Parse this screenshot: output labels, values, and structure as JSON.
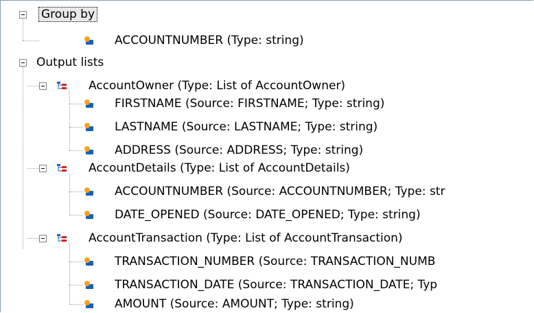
{
  "tree": {
    "group_by": {
      "label": "Group by",
      "items": [
        "ACCOUNTNUMBER (Type: string)"
      ]
    },
    "output_lists": {
      "label": "Output lists",
      "lists": [
        {
          "label": "AccountOwner (Type: List of AccountOwner)",
          "fields": [
            "FIRSTNAME (Source: FIRSTNAME; Type: string)",
            "LASTNAME (Source: LASTNAME; Type: string)",
            "ADDRESS (Source: ADDRESS; Type: string)"
          ]
        },
        {
          "label": "AccountDetails (Type: List of AccountDetails)",
          "fields": [
            "ACCOUNTNUMBER (Source: ACCOUNTNUMBER; Type: str",
            "DATE_OPENED (Source: DATE_OPENED; Type: string)"
          ]
        },
        {
          "label": "AccountTransaction (Type: List of AccountTransaction)",
          "fields": [
            "TRANSACTION_NUMBER (Source: TRANSACTION_NUMB",
            "TRANSACTION_DATE (Source: TRANSACTION_DATE; Typ",
            "AMOUNT (Source: AMOUNT; Type: string)"
          ]
        }
      ]
    }
  },
  "icons": {
    "field": "field-icon",
    "list": "list-icon",
    "collapse": "collapse-icon"
  },
  "colors": {
    "field_icon_blue": "#1560bd",
    "field_icon_orange": "#f7a21b",
    "list_icon_red": "#d42020",
    "list_icon_blue": "#2b5fb5"
  }
}
